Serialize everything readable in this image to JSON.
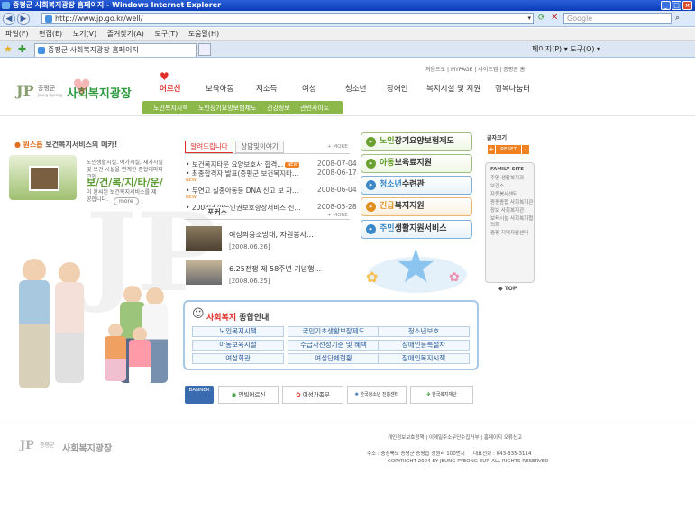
{
  "browser": {
    "window_title": "증평군 사회복지광장 홈페이지 - Windows Internet Explorer",
    "address": "http://www.jp.go.kr/well/",
    "search_placeholder": "Google",
    "menu": [
      "파일(F)",
      "편집(E)",
      "보기(V)",
      "즐겨찾기(A)",
      "도구(T)",
      "도움말(H)"
    ],
    "tab_title": "증평군 사회복지광장 홈페이지",
    "toolbar_right": "페이지(P) ▾  도구(O) ▾"
  },
  "header": {
    "util_links": [
      "처음으로",
      "MYPAGE",
      "사이트맵",
      "증평군 홈"
    ],
    "logo_org": "증평군",
    "logo_org_en": "Jeung Pyeong",
    "logo_title": "사회복지광장",
    "nav": [
      "어르신",
      "보육아동",
      "저소득",
      "여성",
      "청소년",
      "장애인",
      "복지시설 및 지원",
      "행복나눔터"
    ],
    "subnav": [
      "노인복지시책",
      "노인장기요양보험제도",
      "건강정보",
      "관련사이트"
    ]
  },
  "intro": {
    "heading_pre": "원스톱",
    "heading": " 보건복지서비스의 메카!",
    "body": "노인생활시설, 여가시설, 재가시설 및 보건 시설을 연계한 종합테마파크인",
    "slogan": "보/건/복/지/타/운/",
    "body2": "이 완씨된 보건복지서비스를 제공합니다.",
    "more": "more"
  },
  "news": {
    "tabs": [
      "알려드립니다",
      "상담및이야기"
    ],
    "more": "+ MORE",
    "items": [
      {
        "title": "보건복지타운 요양보호사 합격...",
        "new": true,
        "date": "2008-07-04"
      },
      {
        "title": "최종합격자 발표(증평군 보건복지타...",
        "new": false,
        "date": "2008-06-17"
      },
      {
        "title": "무연고 실종아동등 DNA 신고 보 자...",
        "new": true,
        "date": "2008-06-04"
      },
      {
        "title": "2008년 아동인권보호향상서비스 신...",
        "new": true,
        "date": "2008-05-28"
      }
    ],
    "new_label": "NEW"
  },
  "focus": {
    "heading": "포커스",
    "more": "+ MORE",
    "items": [
      {
        "title": "여성의용소방대, 자원봉사...",
        "date": "[2008.06.26]"
      },
      {
        "title": "6.25전쟁 제 58주년 기념행...",
        "date": "[2008.06.25]"
      }
    ]
  },
  "services": [
    {
      "hl": "노인",
      "rest": "장기요양보험제도"
    },
    {
      "hl": "아동",
      "rest": "보육료지원"
    },
    {
      "hl": "청소년",
      "rest": "수련관"
    },
    {
      "hl": "긴급",
      "rest": "복지지원"
    },
    {
      "hl": "주민",
      "rest": "생활지원서비스"
    }
  ],
  "guide": {
    "title_hl": "사회복지",
    "title": " 종합안내",
    "cells": [
      "노인복지시책",
      "국민기초생활보장제도",
      "청소년보호",
      "아동보육시설",
      "수급자선정기준 및 혜택",
      "장애인등록절차",
      "여성회관",
      "여성단체현황",
      "장애인복지시책"
    ]
  },
  "banners": {
    "label": "BANNER",
    "items": [
      "인빌어르신",
      "여성가족부",
      "한국청소년 진흥센터",
      "한국복지재단"
    ]
  },
  "side": {
    "font_label": "글자크기",
    "reset": "RESET",
    "family_title": "FAMILY SITE",
    "family": [
      "주민 생활복지과",
      "보건소",
      "자원봉사센터",
      "증평종합 사회복지관",
      "장보 사회복지관",
      "보육시설 사회복지협의회",
      "증평 지역자활센터"
    ],
    "top": "◆ TOP"
  },
  "footer": {
    "links": [
      "개인정보보호정책",
      "이메일주소무단수집거부",
      "홈페이지 오류신고"
    ],
    "logo_title": "사회복지광장",
    "address": "주소 : 충청북도 증평군 증평읍 청원리 100번지",
    "tel": "대표전화 : 043-835-3114",
    "copyright": "COPYRIGHT 2004 BY JEUNG PYEONG EUP. ALL RIGHTS RESERVED"
  },
  "colors": {
    "accent_green": "#8cb84a",
    "accent_red": "#e0302a",
    "ie_blue": "#1a4cc8"
  }
}
